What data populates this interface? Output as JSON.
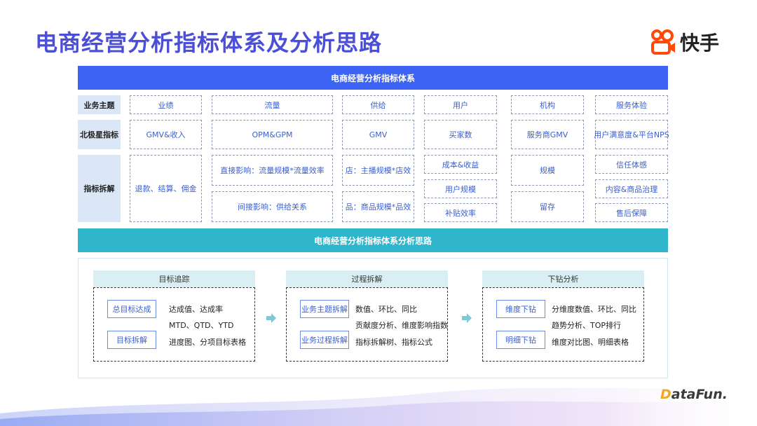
{
  "title": "电商经营分析指标体系及分析思路",
  "brand": {
    "name": "快手",
    "icon": "kuaishou-logo-icon",
    "color": "#ff4906"
  },
  "top_bar": "电商经营分析指标体系",
  "mid_bar": "电商经营分析指标体系分析思路",
  "row_labels": [
    "业务主题",
    "北极星指标",
    "指标拆解"
  ],
  "themes": [
    "业绩",
    "流量",
    "供给",
    "用户",
    "机构",
    "服务体验"
  ],
  "north_star": [
    "GMV&收入",
    "OPM&GPM",
    "GMV",
    "买家数",
    "服务商GMV",
    "用户满意度&平台NPS"
  ],
  "breakdown": {
    "performance": "退款、结算、佣金",
    "traffic": [
      "直接影响：流量规模*流量效率",
      "间接影响：供给关系"
    ],
    "supply": [
      "店：主播规模*店效",
      "品：商品规模*品效"
    ],
    "user": [
      "成本&收益",
      "用户规模",
      "补贴效率"
    ],
    "org": [
      "规模",
      "留存"
    ],
    "service": [
      "信任体感",
      "内容&商品治理",
      "售后保障"
    ]
  },
  "panels": [
    {
      "title": "目标追踪",
      "buttons": [
        "总目标达成",
        "目标拆解"
      ],
      "lines": [
        "达成值、达成率",
        "MTD、QTD、YTD",
        "进度图、分项目标表格"
      ]
    },
    {
      "title": "过程拆解",
      "buttons": [
        "业务主题拆解",
        "业务过程拆解"
      ],
      "lines": [
        "数值、环比、同比",
        "贡献度分析、维度影响指数",
        "指标拆解树、指标公式"
      ]
    },
    {
      "title": "下钻分析",
      "buttons": [
        "维度下钻",
        "明细下钻"
      ],
      "lines": [
        "分维度数值、环比、同比",
        "趋势分析、TOP排行",
        "维度对比图、明细表格"
      ]
    }
  ],
  "footer_logo": {
    "prefix": "D",
    "rest": "ataFun."
  },
  "colors": {
    "title": "#4b4fd8",
    "top_bar": "#3d63f5",
    "mid_bar": "#2fb6cc",
    "cell_text": "#3a5fd0",
    "label_bg": "#dbe6f6",
    "panel_head": "#d9eff4"
  }
}
